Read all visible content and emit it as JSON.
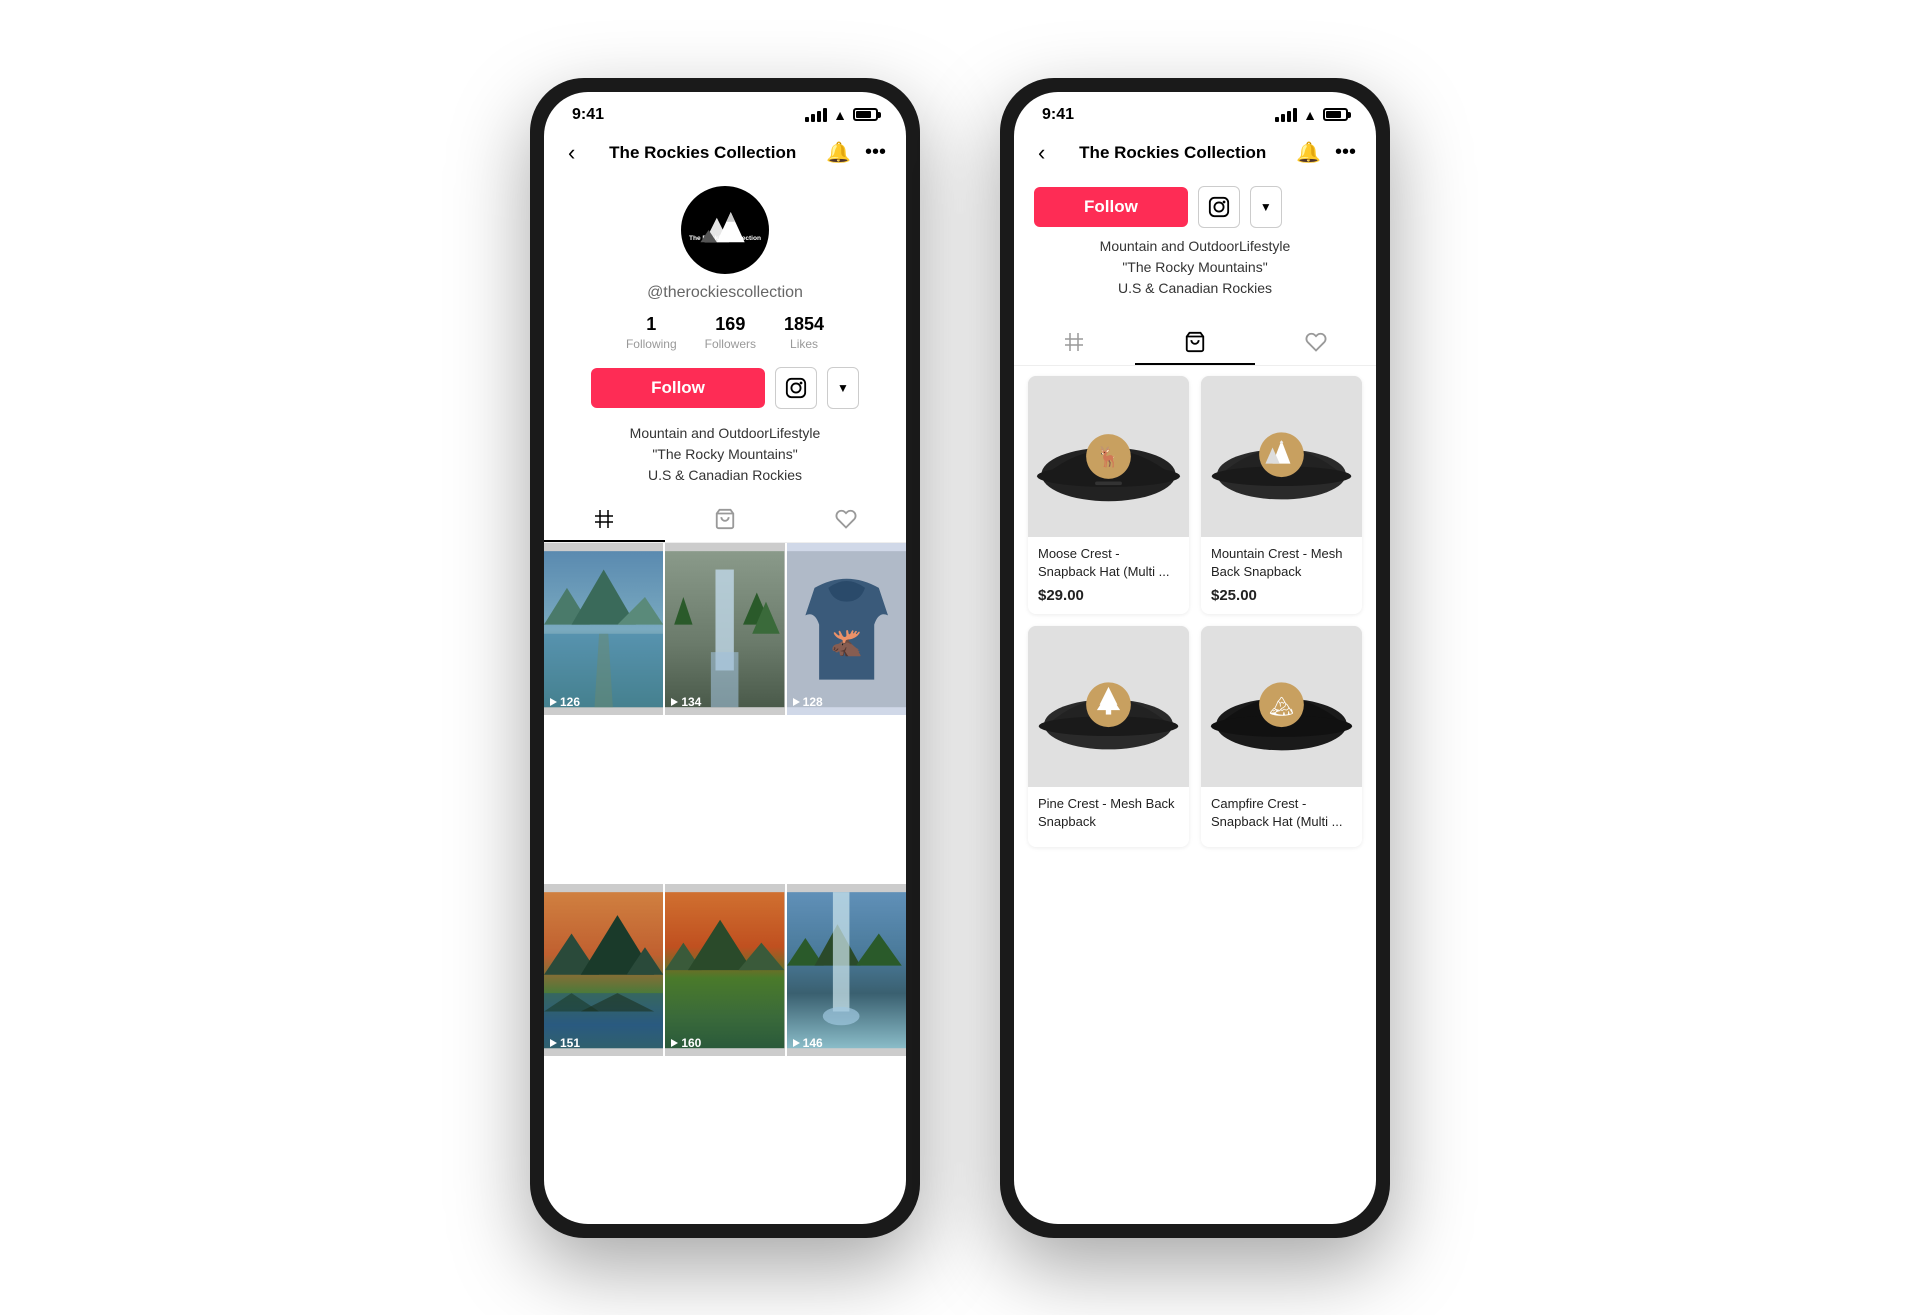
{
  "scene": {
    "background": "#ffffff"
  },
  "phone_left": {
    "status": {
      "time": "9:41"
    },
    "nav": {
      "title": "The Rockies Collection",
      "back_label": "‹"
    },
    "profile": {
      "username": "@therockiescollection",
      "stats": {
        "following": {
          "value": "1",
          "label": "Following"
        },
        "followers": {
          "value": "169",
          "label": "Followers"
        },
        "likes": {
          "value": "1854",
          "label": "Likes"
        }
      },
      "follow_label": "Follow",
      "bio_line1": "Mountain and OutdoorLifestyle",
      "bio_line2": "\"The Rocky Mountains\"",
      "bio_line3": "U.S & Canadian Rockies"
    },
    "tabs": {
      "grid": "⊞",
      "shop": "🛍",
      "liked": "♡"
    },
    "videos": [
      {
        "count": "126"
      },
      {
        "count": "134"
      },
      {
        "count": "128"
      },
      {
        "count": "151"
      },
      {
        "count": "160"
      },
      {
        "count": "146"
      }
    ]
  },
  "phone_right": {
    "status": {
      "time": "9:41"
    },
    "nav": {
      "title": "The Rockies Collection",
      "back_label": "‹"
    },
    "follow_label": "Follow",
    "bio_line1": "Mountain and OutdoorLifestyle",
    "bio_line2": "\"The Rocky Mountains\"",
    "bio_line3": "U.S & Canadian Rockies",
    "products": [
      {
        "id": "p1",
        "name": "Moose Crest - Snapback Hat (Multi ...",
        "price": "$29.00",
        "badge_color": "#c8a060",
        "badge_symbol": "moose"
      },
      {
        "id": "p2",
        "name": "Mountain Crest - Mesh Back Snapback",
        "price": "$25.00",
        "badge_color": "#c8a060",
        "badge_symbol": "mountain"
      },
      {
        "id": "p3",
        "name": "Pine Crest - Mesh Back Snapback",
        "price": "",
        "badge_color": "#c8a060",
        "badge_symbol": "tree"
      },
      {
        "id": "p4",
        "name": "Campfire Crest - Snapback Hat (Multi ...",
        "price": "",
        "badge_color": "#c8a060",
        "badge_symbol": "campfire"
      }
    ]
  }
}
